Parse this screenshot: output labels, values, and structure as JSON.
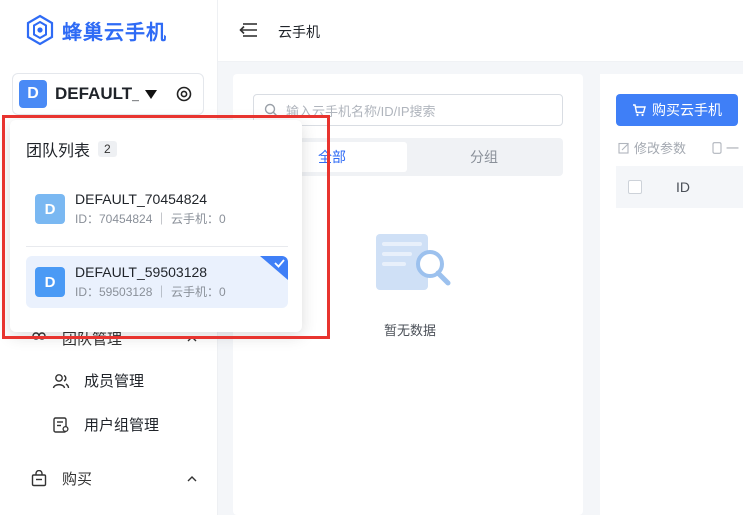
{
  "app": {
    "logo_text": "蜂巢云手机"
  },
  "team_select": {
    "avatar_letter": "D",
    "name": "DEFAULT_..."
  },
  "header": {
    "breadcrumb": "云手机"
  },
  "sidebar": {
    "team_mgmt_label": "团队管理",
    "members_label": "成员管理",
    "user_groups_label": "用户组管理",
    "purchase_label": "购买"
  },
  "search": {
    "placeholder": "输入云手机名称/ID/IP搜索"
  },
  "group_tabs": {
    "all": "全部",
    "groups": "分组"
  },
  "empty": {
    "text": "暂无数据"
  },
  "toolbar": {
    "buy_label": "购买云手机",
    "edit_params_label": "修改参数",
    "more_label": "一"
  },
  "table": {
    "columns": [
      "ID"
    ]
  },
  "team_dropdown": {
    "title": "团队列表",
    "count": "2",
    "teams": [
      {
        "letter": "D",
        "name": "DEFAULT_70454824",
        "meta": "ID：70454824 ｜ 云手机：0"
      },
      {
        "letter": "D",
        "name": "DEFAULT_59503128",
        "meta": "ID：59503128 ｜ 云手机：0"
      }
    ]
  },
  "colors": {
    "accent": "#3f7ff7",
    "highlight": "#e8342f",
    "avatar": "#4a8af5"
  }
}
